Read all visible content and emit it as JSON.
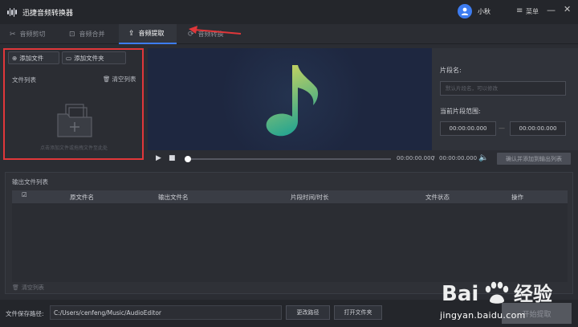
{
  "app": {
    "title": "迅捷音频转换器"
  },
  "header": {
    "user_name": "小秋",
    "menu_label": "菜单",
    "minimize_glyph": "—",
    "close_glyph": "✕"
  },
  "tabs": [
    {
      "label": "音频剪切",
      "icon": "scissors-icon"
    },
    {
      "label": "音频合并",
      "icon": "merge-icon"
    },
    {
      "label": "音频提取",
      "icon": "extract-icon"
    },
    {
      "label": "音频转换",
      "icon": "refresh-icon"
    }
  ],
  "active_tab": "音频提取",
  "file_panel": {
    "add_file": "添加文件",
    "add_folder": "添加文件夹",
    "list_label": "文件列表",
    "clear_list": "清空列表",
    "drop_hint": "点击添加文件或拖拽文件至此处"
  },
  "segment": {
    "name_label": "片段名:",
    "name_placeholder": "默认片段名，可以修改",
    "range_label": "当前片段范围:",
    "start_time": "00:00:00.000",
    "end_time": "00:00:00.000",
    "range_separator": "—"
  },
  "player": {
    "current_time": "00:00:00.000",
    "separator": "/",
    "total_time": "00:00:00.000",
    "confirm_button": "确认并添加到输出列表",
    "progress": 0
  },
  "output": {
    "title": "输出文件列表",
    "columns": [
      "原文件名",
      "输出文件名",
      "片段时间/时长",
      "文件状态",
      "操作"
    ],
    "clear_label": "清空列表"
  },
  "footer": {
    "path_label": "文件保存路径:",
    "path_value": "C:/Users/cenfeng/Music/AudioEditor",
    "change_path": "更改路径",
    "open_folder": "打开文件夹",
    "start_button": "开始提取"
  },
  "watermark": {
    "brand": "Bai经验",
    "url": "jingyan.baidu.com"
  },
  "colors": {
    "accent": "#3d7cf0",
    "highlight": "#e0373a",
    "note_top": "#d8d75a",
    "note_bottom": "#2aa68f"
  }
}
